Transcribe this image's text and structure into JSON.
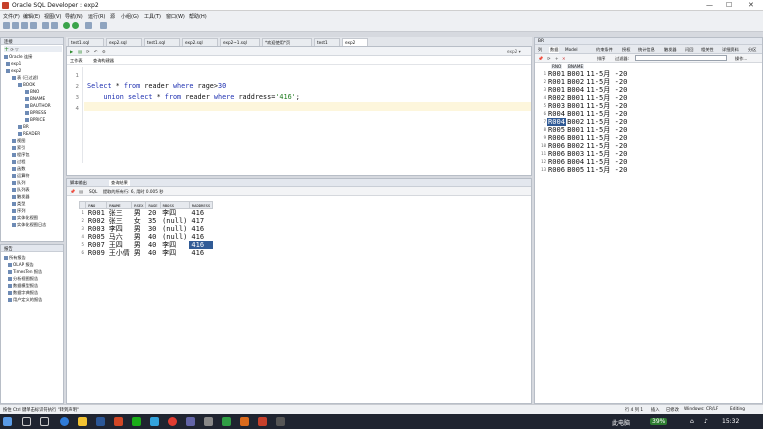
{
  "window": {
    "title": "Oracle SQL Developer : exp2"
  },
  "menu": [
    "文件(F)",
    "编辑(E)",
    "视图(V)",
    "导航(N)",
    "运行(R)",
    "源",
    "小组(G)",
    "工具(T)",
    "窗口(W)",
    "帮助(H)"
  ],
  "editor_tabs": [
    "test1.sql",
    "exp2.sql",
    "test1.sql",
    "exp2.sql",
    "exp2~1.sql",
    "*欢迎使用*页",
    "test1",
    "exp2"
  ],
  "editor": {
    "subtab_worksheet": "工作表",
    "subtab_query_builder": "查询构建器",
    "line_numbers": [
      "1",
      "2",
      "3",
      "4"
    ],
    "line3": {
      "kw1": "Select",
      "star": " * ",
      "kw2": "from",
      "t1": " reader ",
      "kw3": "where",
      "cond": " rage>",
      "num": "30"
    },
    "line4": {
      "indent": "    ",
      "kw1": "union",
      "sp": " ",
      "kw2": "select",
      "star": " * ",
      "kw3": "from",
      "t1": " reader ",
      "kw4": "where",
      "cond": " raddress=",
      "str": "'416'",
      "end": ";"
    }
  },
  "connections": {
    "header": "连接",
    "items": [
      "Oracle 连接",
      "exp1",
      "exp2",
      "表 (已过滤)",
      "BOOK",
      "BNO",
      "BNAME",
      "BAUTHOR",
      "BPRESS",
      "BPRICE",
      "BR",
      "READER",
      "视图",
      "索引",
      "程序包",
      "过程",
      "函数",
      "运算符",
      "队列",
      "队列表",
      "触发器",
      "类型",
      "序列",
      "实体化视图",
      "实体化视图日志"
    ]
  },
  "reports": {
    "header": "报告",
    "items": [
      "所有报告",
      "OLAP 报告",
      "TimesTen 报告",
      "分析视图报告",
      "数据模型报告",
      "数据字典报告",
      "用户定义的报告"
    ]
  },
  "results": {
    "tab_script": "脚本输出",
    "tab_query": "查询结果",
    "sql_label": "SQL",
    "fetch_info": "提取的所有行: 6, 用时 0.005 秒",
    "columns": [
      "RNO",
      "RNAME",
      "RSEX",
      "RAGE",
      "RBOSS",
      "RADDRESS"
    ],
    "rows": [
      [
        "1",
        "R001",
        "张三",
        "男",
        "20",
        "李四",
        "416"
      ],
      [
        "2",
        "R002",
        "张三",
        "女",
        "35",
        "(null)",
        "417"
      ],
      [
        "3",
        "R003",
        "李四",
        "男",
        "30",
        "(null)",
        "416"
      ],
      [
        "4",
        "R005",
        "马六",
        "男",
        "40",
        "(null)",
        "416"
      ],
      [
        "5",
        "R007",
        "王四",
        "男",
        "40",
        "李四",
        "416"
      ],
      [
        "6",
        "R009",
        "王小倩",
        "男",
        "40",
        "李四",
        "416"
      ]
    ]
  },
  "right_panel": {
    "header": "BR",
    "tabs": [
      "列",
      "数据",
      "Model",
      "约束条件",
      "授权",
      "统计信息",
      "触发器",
      "闪回",
      "相关性",
      "详细资料",
      "分区",
      "索引",
      "SQL"
    ],
    "sort_label": "排序",
    "filter_label": "过滤器:",
    "action_label": "操作...",
    "columns": [
      "RNO",
      "BNAME"
    ],
    "rows": [
      [
        "1",
        "R001",
        "B001",
        "11-5月 -20"
      ],
      [
        "2",
        "R001",
        "B002",
        "11-5月 -20"
      ],
      [
        "3",
        "R001",
        "B004",
        "11-5月 -20"
      ],
      [
        "4",
        "R002",
        "B001",
        "11-5月 -20"
      ],
      [
        "5",
        "R003",
        "B001",
        "11-5月 -20"
      ],
      [
        "6",
        "R004",
        "B001",
        "11-5月 -20"
      ],
      [
        "7",
        "R004",
        "B002",
        "11-5月 -20"
      ],
      [
        "8",
        "R005",
        "B001",
        "11-5月 -20"
      ],
      [
        "9",
        "R006",
        "B001",
        "11-5月 -20"
      ],
      [
        "10",
        "R006",
        "B002",
        "11-5月 -20"
      ],
      [
        "11",
        "R006",
        "B003",
        "11-5月 -20"
      ],
      [
        "12",
        "R006",
        "B004",
        "11-5月 -20"
      ],
      [
        "13",
        "R006",
        "B005",
        "11-5月 -20"
      ]
    ]
  },
  "status": {
    "left": "按住 Ctrl 键单击标识符执行 \"转到声明\"",
    "right1": "行 4 列 1",
    "right2": "插入",
    "right3": "已修改",
    "right4": "Windows: CR/LF",
    "right5": "Editing"
  },
  "taskbar": {
    "time": "15:32",
    "tray_label": "此电脑",
    "battery": "39%"
  }
}
